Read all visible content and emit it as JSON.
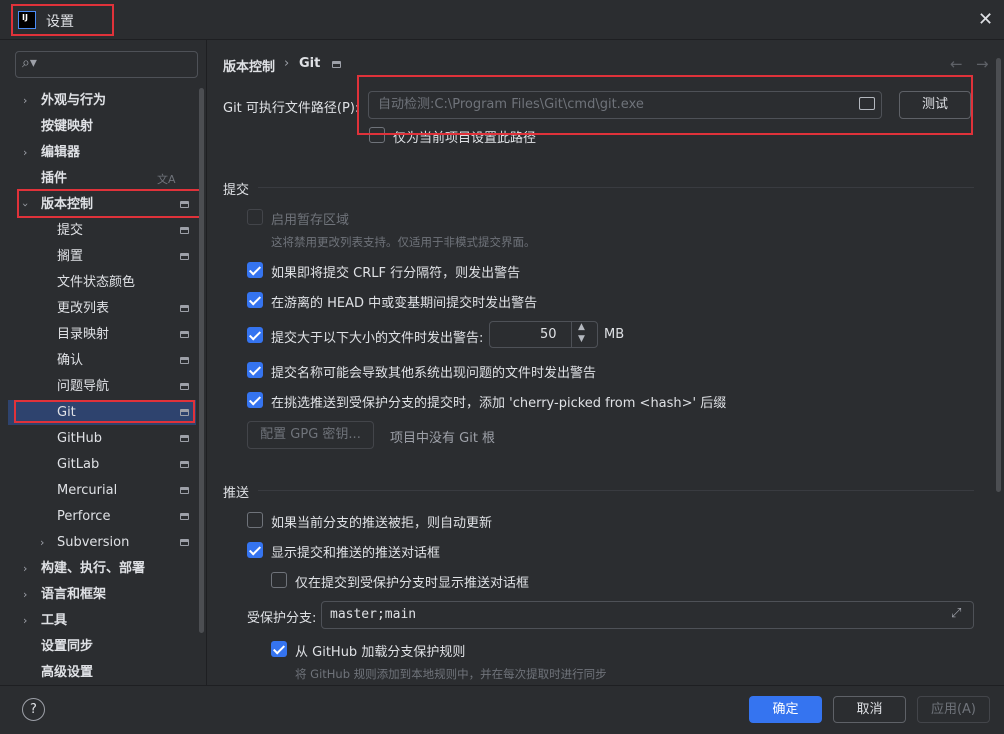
{
  "window": {
    "title": "设置",
    "logo_text": "IJ",
    "close_symbol": "✕"
  },
  "search": {
    "icon": "search-icon",
    "placeholder": ""
  },
  "sidebar": {
    "items": [
      {
        "label": "外观与行为",
        "expandable": true,
        "expanded": false
      },
      {
        "label": "按键映射"
      },
      {
        "label": "编辑器",
        "expandable": true,
        "expanded": false
      },
      {
        "label": "插件",
        "icon": "translate-icon"
      },
      {
        "label": "版本控制",
        "expandable": true,
        "expanded": true
      },
      {
        "label": "提交"
      },
      {
        "label": "搁置"
      },
      {
        "label": "文件状态颜色"
      },
      {
        "label": "更改列表"
      },
      {
        "label": "目录映射"
      },
      {
        "label": "确认"
      },
      {
        "label": "问题导航"
      },
      {
        "label": "Git",
        "selected": true
      },
      {
        "label": "GitHub"
      },
      {
        "label": "GitLab"
      },
      {
        "label": "Mercurial"
      },
      {
        "label": "Perforce"
      },
      {
        "label": "Subversion",
        "expandable": true,
        "expanded": false
      },
      {
        "label": "构建、执行、部署",
        "expandable": true,
        "expanded": false
      },
      {
        "label": "语言和框架",
        "expandable": true,
        "expanded": false
      },
      {
        "label": "工具",
        "expandable": true,
        "expanded": false
      },
      {
        "label": "设置同步"
      },
      {
        "label": "高级设置"
      }
    ]
  },
  "breadcrumb": {
    "parent": "版本控制",
    "separator": "›",
    "current": "Git"
  },
  "nav_arrows": {
    "back": "←",
    "forward": "→"
  },
  "git_path": {
    "label": "Git 可执行文件路径(P):",
    "placeholder": "自动检测:C:\\Program Files\\Git\\cmd\\git.exe",
    "test_label": "测试",
    "project_only_label": "仅为当前项目设置此路径",
    "project_only_checked": false
  },
  "commit_section": {
    "title": "提交",
    "staging": {
      "label": "启用暂存区域",
      "checked": false,
      "disabled": true,
      "hint": "这将禁用更改列表支持。仅适用于非模式提交界面。"
    },
    "crlf": {
      "label": "如果即将提交 CRLF 行分隔符，则发出警告",
      "checked": true
    },
    "detached": {
      "label": "在游离的 HEAD 中或变基期间提交时发出警告",
      "checked": true
    },
    "large_file": {
      "label": "提交大于以下大小的文件时发出警告:",
      "checked": true,
      "value": "50",
      "unit": "MB"
    },
    "file_names": {
      "label": "提交名称可能会导致其他系统出现问题的文件时发出警告",
      "checked": true
    },
    "cherry_pick": {
      "label": "在挑选推送到受保护分支的提交时，添加 'cherry-picked from <hash>' 后缀",
      "checked": true
    },
    "gpg_button": "配置 GPG 密钥...",
    "no_git_root": "项目中没有 Git 根"
  },
  "push_section": {
    "title": "推送",
    "auto_update": {
      "label": "如果当前分支的推送被拒，则自动更新",
      "checked": false
    },
    "show_dialog": {
      "label": "显示提交和推送的推送对话框",
      "checked": true
    },
    "protected_only": {
      "label": "仅在提交到受保护分支时显示推送对话框",
      "checked": false
    },
    "protected_branches_label": "受保护分支:",
    "protected_branches_value": "master;main",
    "github_rules": {
      "label": "从 GitHub 加载分支保护规则",
      "checked": true,
      "hint": "将 GitHub 规则添加到本地规则中，并在每次提取时进行同步"
    }
  },
  "footer": {
    "help": "?",
    "ok": "确定",
    "cancel": "取消",
    "apply": "应用(A)"
  },
  "colors": {
    "accent": "#3574f0",
    "selection": "#2e436e",
    "highlight": "#e0323a",
    "background": "#2b2d30"
  }
}
